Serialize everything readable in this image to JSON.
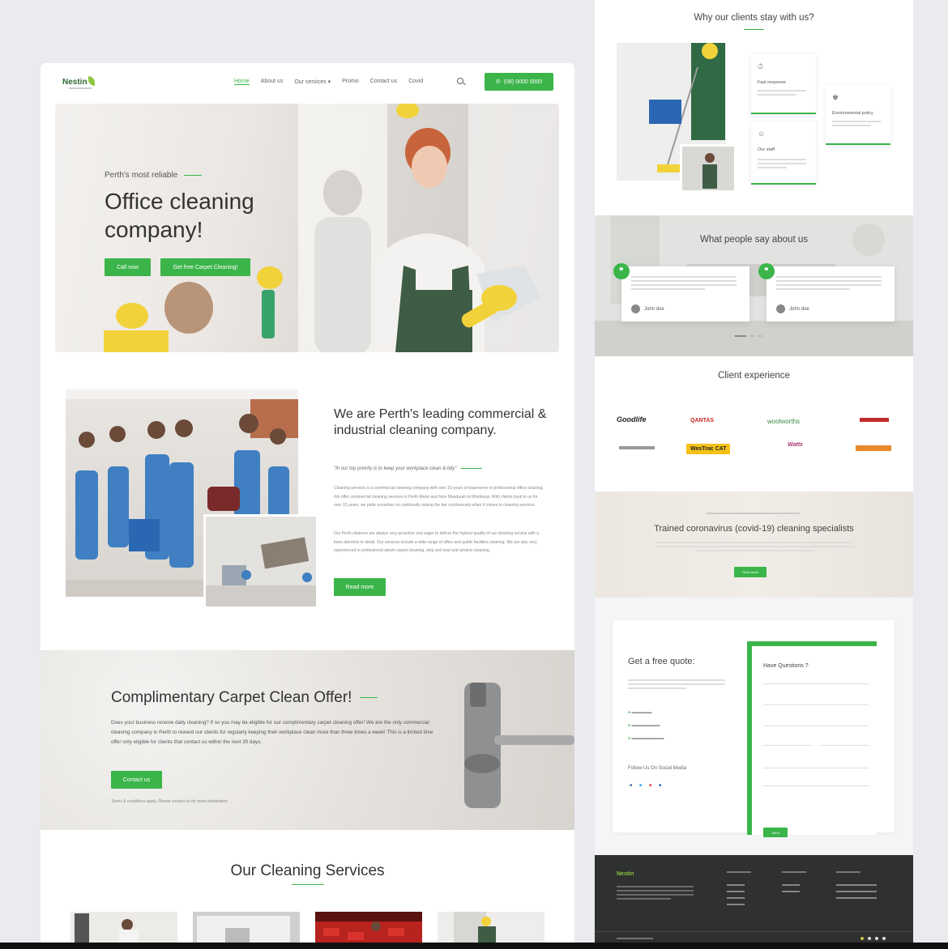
{
  "nav": {
    "logo": "Nestin",
    "items": [
      "Home",
      "About us",
      "Our services",
      "Promo",
      "Contact us",
      "Covid"
    ],
    "call": "(08) 0000 0000"
  },
  "hero": {
    "kicker": "Perth's most reliable",
    "title": "Office cleaning company!",
    "btn_call": "Call now",
    "btn_carpet": "Get free Carpet Cleaning!"
  },
  "about": {
    "title": "We are Perth's leading commercial & industrial cleaning company.",
    "quote": "\"In our top priority is to keep your workplace clean & tidy\"",
    "p1": "Cleaning services is a commercial cleaning company with over 15 years of experience in professional office cleaning. We offer commercial cleaning services in Perth Metro and from Mandurah to Mindiarup. With clients loyal to us for over 15 years, we pride ourselves on continually raising the bar continuously when it comes to cleaning services.",
    "p2": "Our Perth cleaners are always very proactive and eager to deliver the highest quality of our cleaning service with a keen attention to detail. Our services include a wide range of office and public facilities cleaning. We are also very experienced in professional steam carpet cleaning, strip and seal and window cleaning.",
    "btn": "Read more"
  },
  "carpet": {
    "title": "Complimentary Carpet Clean Offer!",
    "text": "Does your business receive daily cleaning? If so you may be eligible for our complimentary carpet cleaning offer! We are the only commercial cleaning company in Perth to reward our clients for regularly keeping their workplace clean more than three times a week! This is a limited time offer only eligible for clients that contact us within the next 30 days.",
    "btn": "Contact us",
    "note": "Terms & conditions apply. Please contact us for more information."
  },
  "services": {
    "title": "Our Cleaning Services"
  },
  "why": {
    "title": "Why our clients stay with us?",
    "cards": [
      "Fast response",
      "Environmental policy",
      "Our staff"
    ]
  },
  "testimonials": {
    "title": "What people say about us",
    "items": [
      {
        "name": "John doe"
      },
      {
        "name": "John doe"
      }
    ]
  },
  "clients": {
    "title": "Client experience",
    "logos": [
      "Goodlife",
      "QANTAS",
      "woolworths",
      "WesTrac CAT",
      "Watts"
    ]
  },
  "covid": {
    "title": "Trained coronavirus (covid-19) cleaning specialists",
    "btn": "Read more"
  },
  "quote": {
    "title": "Get a free quote:",
    "form_title": "Have Questions ?",
    "social": "Follow Us On Social Media",
    "submit": "Send"
  },
  "colors": {
    "accent": "#3bb54a",
    "footer": "#2f3030"
  },
  "icons": [
    "search-icon",
    "phone-icon",
    "quote-icon"
  ]
}
